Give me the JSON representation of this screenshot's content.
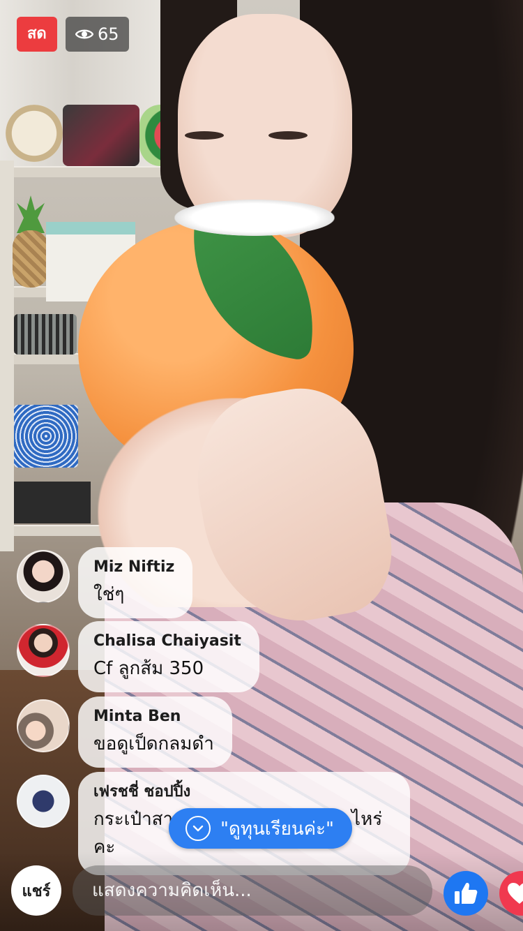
{
  "live": {
    "badge": "สด",
    "viewer_count": "65"
  },
  "comments": [
    {
      "name": "Miz Niftiz",
      "text": "ใช่ๆ"
    },
    {
      "name": "Chalisa Chaiyasit",
      "text": "Cf ลูกส้ม 350"
    },
    {
      "name": "Minta Ben",
      "text": "ขอดูเป็ดกลมดำ"
    },
    {
      "name": "เฟรชชี่ ชอปปิ้ง",
      "text": "กระเป๋าสา",
      "text_tail": "ไหร่",
      "text_line2": "คะ"
    }
  ],
  "new_comment_pill": "\"ดูทุนเรียนค่ะ\"",
  "bottom_bar": {
    "share_label": "แชร์",
    "comment_placeholder": "แสดงความคิดเห็น..."
  },
  "icons": {
    "viewers": "eye-icon",
    "new_comments": "chevron-down-icon",
    "like": "thumbs-up-icon",
    "love": "heart-icon"
  },
  "colors": {
    "live_red": "#ec3c3f",
    "facebook_blue": "#1e77f2",
    "pill_blue": "#2d7ff2",
    "love_red": "#f0394f"
  }
}
